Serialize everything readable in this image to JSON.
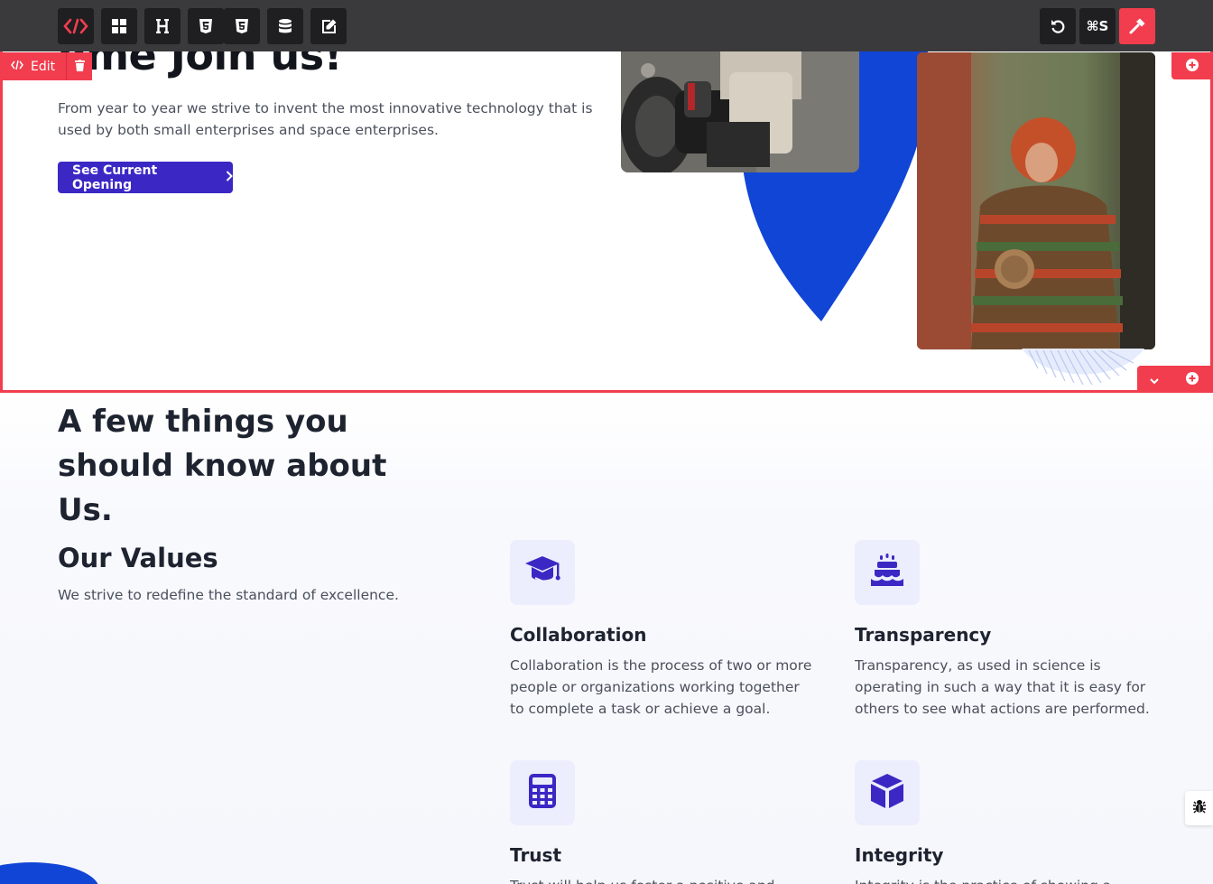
{
  "colors": {
    "accent": "#f23d4e",
    "toolbar_bg": "#3a3a3c",
    "button_primary": "#3b28c4",
    "shape_blue": "#1145d6",
    "icon_tile": "#eceefd"
  },
  "toolbar": {
    "buttons": [
      {
        "name": "logo",
        "icon": "code-brackets-icon"
      },
      {
        "name": "blocks",
        "icon": "grid-icon"
      },
      {
        "name": "heading",
        "icon": "heading-icon",
        "label": "H"
      },
      {
        "name": "html",
        "icon": "html5-icon"
      },
      {
        "name": "css",
        "icon": "css3-icon"
      },
      {
        "name": "database",
        "icon": "database-icon"
      },
      {
        "name": "edit",
        "icon": "edit-icon"
      }
    ],
    "undo_icon": "undo-icon",
    "save_label": "⌘S",
    "build_icon": "hammer-icon"
  },
  "selection": {
    "edit_label": "Edit",
    "edit_icon": "code-icon",
    "trash_icon": "trash-icon",
    "add_icon": "plus-circle-icon",
    "collapse_icon": "chevron-down-icon"
  },
  "hero": {
    "title": "ome Join us!",
    "description": "From year to year we strive to invent the most innovative technology that is used by both small enterprises and space enterprises.",
    "cta_label": "See Current Opening",
    "cta_icon": "chevron-right-icon"
  },
  "about": {
    "title": "A few things you should know about Us.",
    "values_title": "Our Values",
    "values_subtitle": "We strive to redefine the standard of excellence.",
    "cards": [
      {
        "icon": "graduation-cap-icon",
        "title": "Collaboration",
        "text": "Collaboration is the process of two or more people or organizations working together to complete a task or achieve a goal."
      },
      {
        "icon": "birthday-cake-icon",
        "title": "Transparency",
        "text": "Transparency, as used in science is operating in such a way that it is easy for others to see what actions are performed."
      },
      {
        "icon": "calculator-icon",
        "title": "Trust",
        "text": "Trust will help us foster a positive and"
      },
      {
        "icon": "cube-icon",
        "title": "Integrity",
        "text": "Integrity is the practice of showing a consistent"
      }
    ]
  },
  "debug_icon": "bug-icon"
}
